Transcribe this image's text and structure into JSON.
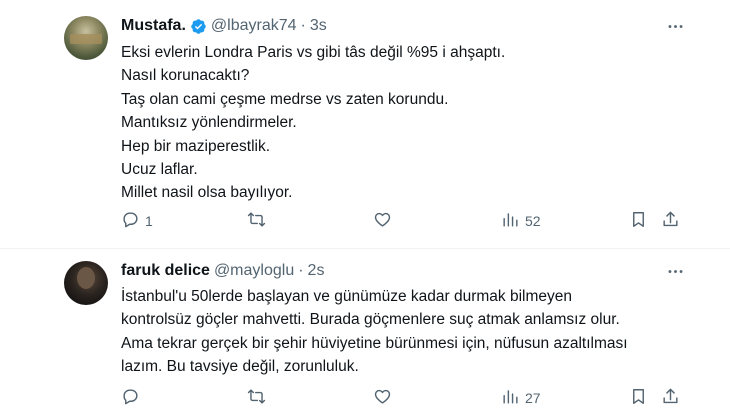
{
  "tweets": [
    {
      "name": "Mustafa.",
      "handle": "@lbayrak74",
      "dot": "·",
      "time": "3s",
      "verified": true,
      "lines": [
        "Eksi evlerin Londra Paris vs gibi tâs değil %95 i ahşaptı.",
        "Nasıl korunacaktı?",
        "Taş olan cami çeşme medrse vs zaten korundu.",
        "Mantıksız yönlendirmeler.",
        "Hep bir maziperestlik.",
        "Ucuz laflar.",
        "Millet nasil olsa bayılıyor."
      ],
      "reply_count": "1",
      "retweet_count": "",
      "like_count": "",
      "views_count": "52"
    },
    {
      "name": "faruk delice",
      "handle": "@mayloglu",
      "dot": "·",
      "time": "2s",
      "verified": false,
      "lines": [
        "İstanbul'u 50lerde başlayan ve günümüze kadar durmak bilmeyen",
        "kontrolsüz göçler mahvetti. Burada göçmenlere suç atmak anlamsız olur.",
        "Ama tekrar gerçek bir şehir hüviyetine bürünmesi için, nüfusun azaltılması",
        "lazım. Bu tavsiye değil, zorunluluk."
      ],
      "reply_count": "",
      "retweet_count": "",
      "like_count": "",
      "views_count": "27"
    }
  ],
  "icons": {
    "more": "more-horizontal-icon",
    "reply": "reply-icon",
    "retweet": "retweet-icon",
    "like": "like-icon",
    "views": "views-icon",
    "bookmark": "bookmark-icon",
    "share": "share-icon",
    "verified": "verified-badge-icon"
  },
  "colors": {
    "text": "#0f1419",
    "secondary": "#536471",
    "verified": "#1d9bf0",
    "divider": "#eff3f4"
  }
}
